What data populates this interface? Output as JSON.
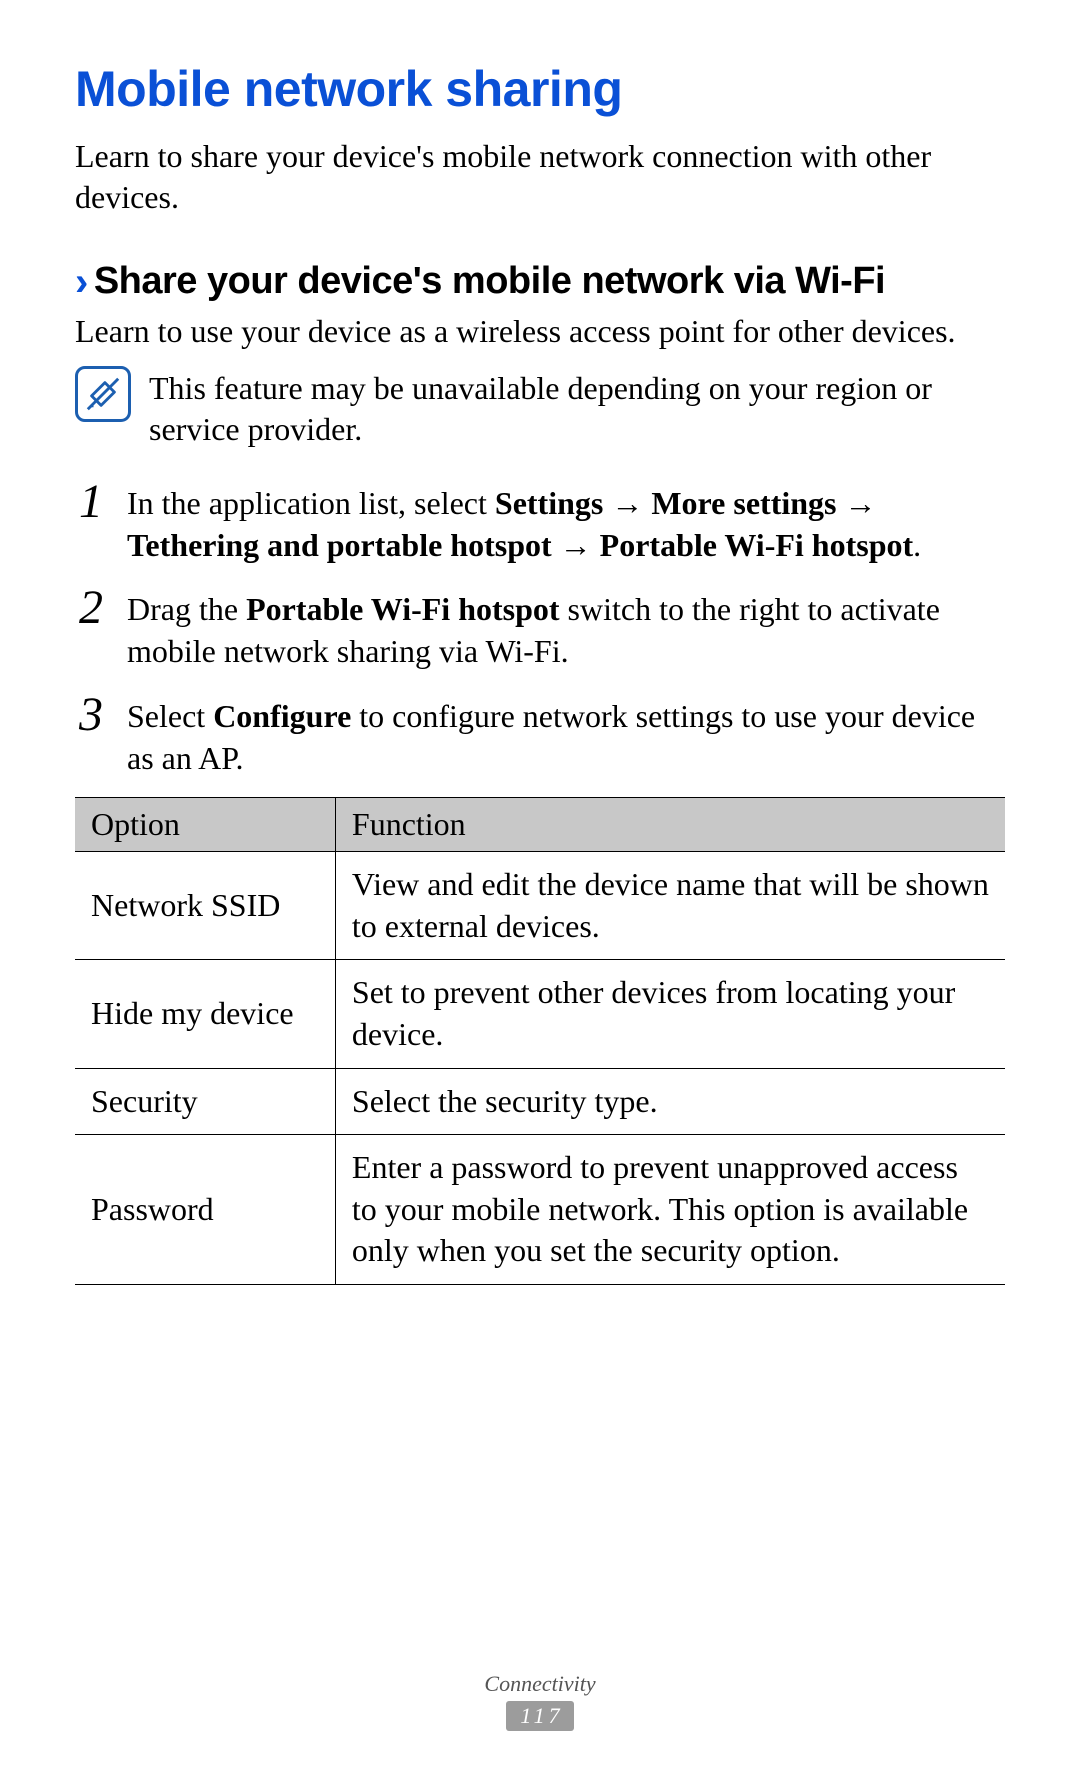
{
  "title": "Mobile network sharing",
  "intro": "Learn to share your device's mobile network connection with other devices.",
  "section": {
    "heading": "Share your device's mobile network via Wi-Fi",
    "intro": "Learn to use your device as a wireless access point for other devices.",
    "note": "This feature may be unavailable depending on your region or service provider."
  },
  "steps": {
    "s1": {
      "num": "1",
      "pre": "In the application list, select ",
      "bold": "Settings → More settings → Tethering and portable hotspot → Portable Wi-Fi hotspot",
      "post": "."
    },
    "s2": {
      "num": "2",
      "pre": "Drag the ",
      "bold": "Portable Wi-Fi hotspot",
      "post": " switch to the right to activate mobile network sharing via Wi-Fi."
    },
    "s3": {
      "num": "3",
      "pre": "Select ",
      "bold": "Configure",
      "post": " to configure network settings to use your device as an AP."
    }
  },
  "table": {
    "headers": {
      "option": "Option",
      "function": "Function"
    },
    "rows": {
      "r1": {
        "option": "Network SSID",
        "function": "View and edit the device name that will be shown to external devices."
      },
      "r2": {
        "option": "Hide my device",
        "function": "Set to prevent other devices from locating your device."
      },
      "r3": {
        "option": "Security",
        "function": "Select the security type."
      },
      "r4": {
        "option": "Password",
        "function": "Enter a password to prevent unapproved access to your mobile network. This option is available only when you set the security option."
      }
    }
  },
  "footer": {
    "section": "Connectivity",
    "page": "117"
  }
}
